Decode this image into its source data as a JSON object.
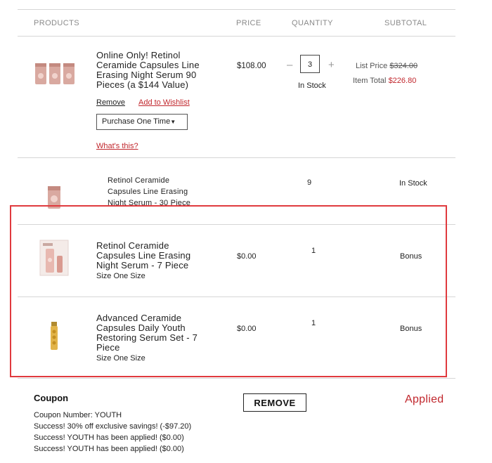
{
  "table": {
    "headers": [
      "PRODUCTS",
      "PRICE",
      "QUANTITY",
      "SUBTOTAL"
    ]
  },
  "item1": {
    "name_lines": [
      "Online Only! Retinol",
      "Ceramide Capsules Line",
      "Erasing Night Serum 90",
      "Pieces (a $144 Value)"
    ],
    "price": "$108.00",
    "quantity": "3",
    "stock": "In Stock",
    "list_price_label": "List Price",
    "list_price": "$324.00",
    "item_total_label": "Item Total",
    "item_total": "$226.80",
    "remove_label": "Remove",
    "wishlist_label": "Add to Wishlist",
    "purchase_option": "Purchase One Time",
    "whats_this": "What's this?"
  },
  "item2": {
    "name_lines": [
      "Retinol Ceramide",
      "Capsules Line Erasing",
      "Night Serum - 30 Piece"
    ],
    "quantity": "9",
    "stock": "In Stock"
  },
  "item3": {
    "name_lines": [
      "Retinol Ceramide",
      "Capsules Line Erasing",
      "Night Serum - 7 Piece"
    ],
    "size": "Size One Size",
    "price": "$0.00",
    "quantity": "1",
    "subtotal": "Bonus"
  },
  "item4": {
    "name_lines": [
      "Advanced Ceramide",
      "Capsules Daily Youth",
      "Restoring Serum Set - 7",
      "Piece"
    ],
    "size": "Size One Size",
    "price": "$0.00",
    "quantity": "1",
    "subtotal": "Bonus"
  },
  "coupon": {
    "title": "Coupon",
    "lines": [
      "Coupon Number: YOUTH",
      "Success! 30% off exclusive savings! (-$97.20)",
      "Success! YOUTH has been applied! ($0.00)",
      "Success! YOUTH has been applied! ($0.00)"
    ],
    "remove_button": "REMOVE",
    "status": "Applied"
  },
  "colors": {
    "accent_red": "#c1272d",
    "highlight_frame": "#e03a3e"
  }
}
